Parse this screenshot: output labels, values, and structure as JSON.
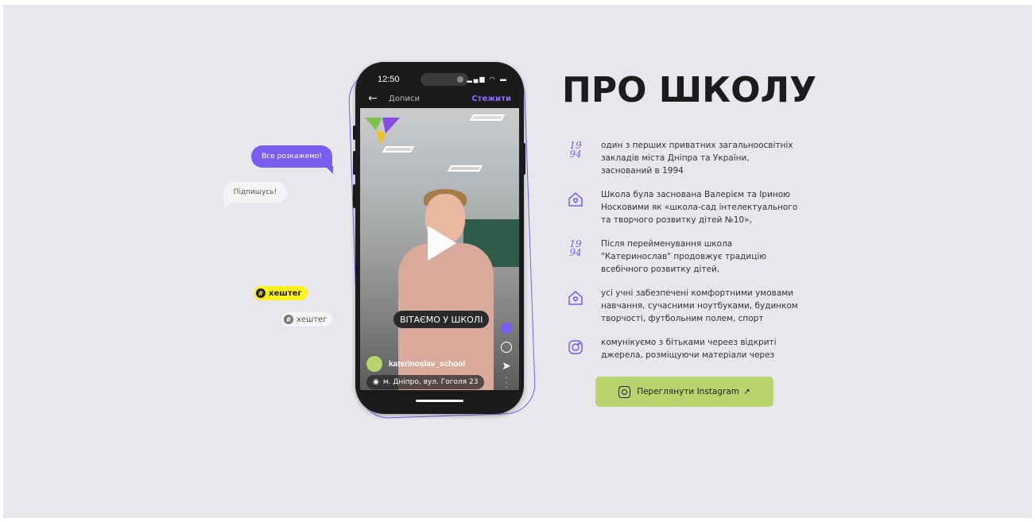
{
  "bubbles": {
    "purple": "Все розкажемо!",
    "white": "Підпишусь!"
  },
  "tags": {
    "yellow": "хештег",
    "gray": "хештег"
  },
  "phone": {
    "time": "12:50",
    "nav_title": "Дописи",
    "follow": "Стежити",
    "caption": "ВІТАЄМО У ШКОЛІ",
    "account": "katerinoslav_school",
    "location": "м. Дніпро, вул. Гоголя 23"
  },
  "about": {
    "title": "ПРО ШКОЛУ",
    "facts": [
      {
        "icon": "year-1994-icon",
        "year_top": "19",
        "year_bottom": "94",
        "text": "один з перших приватних загальноосвітніх закладів міста Дніпра та України, заснований в 1994"
      },
      {
        "icon": "house-heart-icon",
        "text": "Школа була заснована Валерієм та Іриною Носковими як «школа-сад інтелектуального та творчого розвитку дітей №10»,"
      },
      {
        "icon": "year-1994-icon",
        "year_top": "19",
        "year_bottom": "94",
        "text": "Після перейменування школа \"Катеринослав\" продовжує традицію всебічного розвитку дітей,"
      },
      {
        "icon": "house-heart-icon",
        "text": "усі учні забезпечені комфортними умовами навчання, сучасними ноутбуками, будинком творчості, футбольним полем, спорт"
      },
      {
        "icon": "instagram-icon",
        "text": "комунікуємо з бітьками череез відкриті джерела, розміщуючи матеріали через"
      }
    ],
    "button": "Переглянути Instagram",
    "button_arrow": "↗"
  },
  "colors": {
    "accent": "#7b5cf0",
    "button": "#b7d46e",
    "background": "#e8e7ec",
    "tag_yellow": "#fff21e"
  }
}
